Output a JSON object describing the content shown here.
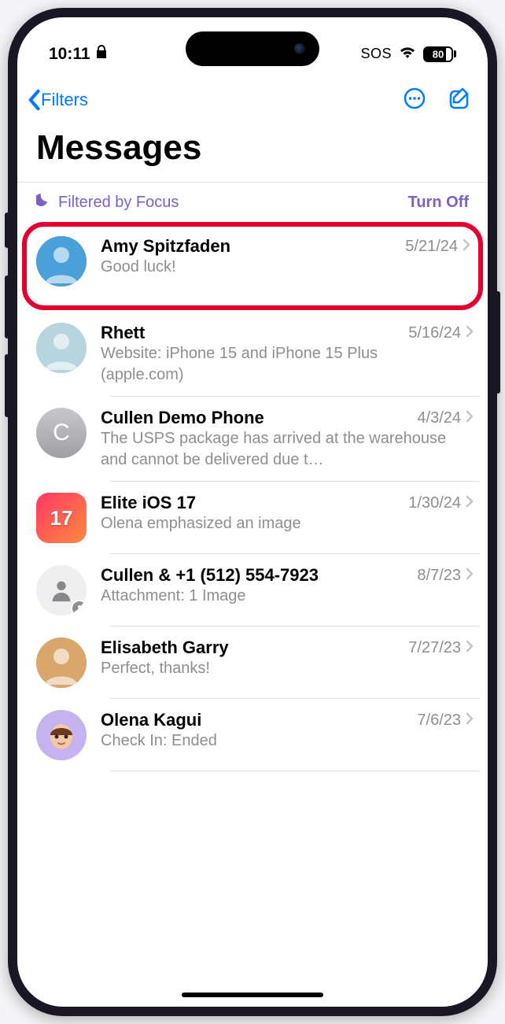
{
  "status": {
    "time": "10:11",
    "sos": "SOS",
    "battery": "80"
  },
  "nav": {
    "back_label": "Filters"
  },
  "title": "Messages",
  "focus": {
    "label": "Filtered by Focus",
    "action": "Turn Off"
  },
  "conversations": [
    {
      "name": "Amy Spitzfaden",
      "date": "5/21/24",
      "preview": "Good luck!",
      "avatar": {
        "type": "photo",
        "bg": "#4aa0d9"
      },
      "highlighted": true
    },
    {
      "name": "Rhett",
      "date": "5/16/24",
      "preview": "Website: iPhone 15 and iPhone 15 Plus (apple.com)",
      "avatar": {
        "type": "photo",
        "bg": "#b7d5de"
      }
    },
    {
      "name": "Cullen Demo Phone",
      "date": "4/3/24",
      "preview": "The USPS package has arrived at the warehouse and cannot be delivered due t…",
      "avatar": {
        "type": "initial",
        "text": "C",
        "bg": "#bfbfc3"
      }
    },
    {
      "name": "Elite iOS 17",
      "date": "1/30/24",
      "preview": "Olena emphasized an image",
      "avatar": {
        "type": "ios17",
        "bg": "#ff2d55"
      }
    },
    {
      "name": "Cullen & +1 (512) 554-7923",
      "date": "8/7/23",
      "preview": "Attachment: 1 Image",
      "avatar": {
        "type": "group",
        "bg": "#e6e6e8"
      }
    },
    {
      "name": "Elisabeth Garry",
      "date": "7/27/23",
      "preview": "Perfect, thanks!",
      "avatar": {
        "type": "photo",
        "bg": "#d9a76b"
      }
    },
    {
      "name": "Olena Kagui",
      "date": "7/6/23",
      "preview": "Check In: Ended",
      "avatar": {
        "type": "memoji",
        "bg": "#c4b3ef"
      }
    }
  ]
}
